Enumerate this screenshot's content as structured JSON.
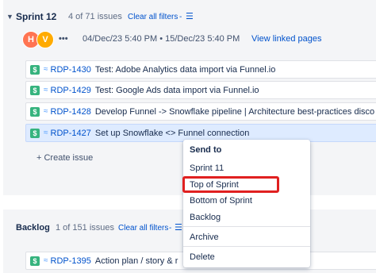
{
  "sprint": {
    "title": "Sprint 12",
    "count": "4 of 71 issues",
    "clear_filters": "Clear all filters",
    "filter_suffix": "-",
    "avatars": [
      {
        "initial": "H",
        "color": "#ff7452"
      },
      {
        "initial": "V",
        "color": "#ffab00"
      }
    ],
    "more": "•••",
    "dates": "04/Dec/23 5:40 PM • 15/Dec/23 5:40 PM",
    "view_linked": "View linked pages",
    "issues": [
      {
        "key": "RDP-1430",
        "summary": "Test: Adobe Analytics data import via Funnel.io"
      },
      {
        "key": "RDP-1429",
        "summary": "Test: Google Ads data import via Funnel.io"
      },
      {
        "key": "RDP-1428",
        "summary": "Develop Funnel -> Snowflake pipeline | Architecture best-practices disco"
      },
      {
        "key": "RDP-1427",
        "summary": "Set up Snowflake <> Funnel connection"
      }
    ],
    "story_glyph": "$",
    "priority_glyph": "≈",
    "create_issue": "+ Create issue"
  },
  "backlog": {
    "title": "Backlog",
    "count": "1 of 151 issues",
    "clear_filters": "Clear all filters",
    "filter_suffix": "-",
    "issues": [
      {
        "key": "RDP-1395",
        "summary": "Action plan / story & r"
      }
    ]
  },
  "context_menu": {
    "heading": "Send to",
    "items": [
      "Sprint 11",
      "Top of Sprint",
      "Bottom of Sprint",
      "Backlog",
      "Archive",
      "Delete"
    ],
    "highlighted": "Top of Sprint"
  },
  "colors": {
    "accent": "#0052cc",
    "story": "#36b37e",
    "highlight_border": "#e02020",
    "selected_row": "#deebff"
  }
}
